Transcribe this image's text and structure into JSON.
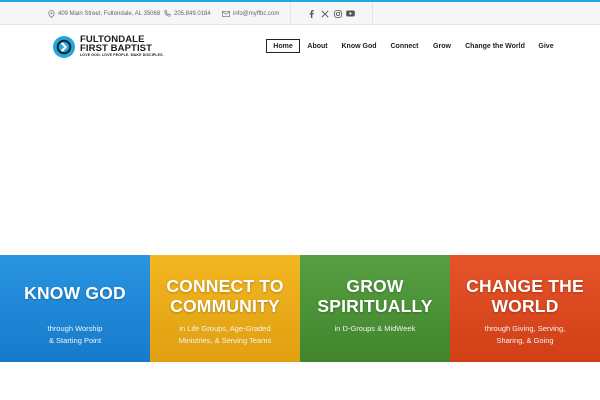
{
  "topbar": {
    "address": "409 Main Street, Fultondale, AL 35068",
    "phone": "205.849.0184",
    "email": "info@myffbc.com",
    "social": [
      "facebook-icon",
      "x-icon",
      "instagram-icon",
      "youtube-icon"
    ]
  },
  "logo": {
    "line1": "FULTONDALE",
    "line2": "FIRST BAPTIST",
    "tagline": "LOVE GOD. LOVE PEOPLE. MAKE DISCIPLES."
  },
  "nav": {
    "items": [
      {
        "label": "Home",
        "active": true
      },
      {
        "label": "About"
      },
      {
        "label": "Know God"
      },
      {
        "label": "Connect"
      },
      {
        "label": "Grow"
      },
      {
        "label": "Change the World"
      },
      {
        "label": "Give"
      }
    ]
  },
  "tiles": [
    {
      "title": "KNOW GOD",
      "sub1": "through Worship",
      "sub2": "& Starting Point",
      "color": "#1e8fe0"
    },
    {
      "title1": "CONNECT TO",
      "title2": "COMMUNITY",
      "sub1": "in Life Groups, Age-Graded",
      "sub2": "Ministries, & Serving Teams",
      "color": "#f2b316"
    },
    {
      "title1": "GROW",
      "title2": "SPIRITUALLY",
      "sub1": "in D-Groups & MidWeek",
      "color": "#4f9a38"
    },
    {
      "title1": "CHANGE THE",
      "title2": "WORLD",
      "sub1": "through Giving, Serving,",
      "sub2": "Sharing, & Going",
      "color": "#e44a1e"
    }
  ],
  "colors": {
    "accent": "#1fa9e0"
  }
}
